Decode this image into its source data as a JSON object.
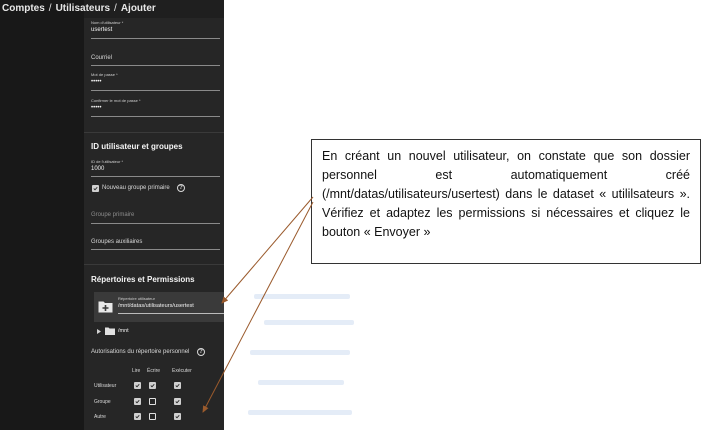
{
  "breadcrumb": [
    "Comptes",
    "Utilisateurs",
    "Ajouter"
  ],
  "breadcrumb_separator": "/",
  "form": {
    "username_label": "Nom d'utilisateur *",
    "username_value": "usertest",
    "email_label": "Courriel",
    "password_label": "Mot de passe *",
    "password_value": "•••••",
    "confirm_label": "Confirmer le mot de passe *",
    "confirm_value": "•••••",
    "section_ids": "ID utilisateur et groupes",
    "uid_label": "ID de l'utilisateur *",
    "uid_value": "1000",
    "new_group_label": "Nouveau groupe primaire",
    "new_group_checked": true,
    "primary_group_label": "Groupe primaire",
    "aux_groups_label": "Groupes auxiliaires",
    "section_dirs": "Répertoires et Permissions",
    "home_dir_label": "Répertoire utilisateur",
    "home_dir_value": "/mnt/datas/utilisateurs/usertest",
    "tree_item": "/mnt",
    "perms_title": "Autorisations du répertoire personnel",
    "perms_columns": [
      "Lire",
      "Écrire",
      "Exécuter"
    ],
    "perms_rows": [
      {
        "label": "Utilisateur",
        "values": [
          true,
          true,
          true
        ]
      },
      {
        "label": "Groupe",
        "values": [
          true,
          false,
          true
        ]
      },
      {
        "label": "Autre",
        "values": [
          true,
          false,
          true
        ]
      }
    ]
  },
  "icons": {
    "help": "help-circle-icon",
    "folder_add": "folder-plus-icon",
    "folder": "folder-icon",
    "expand": "chevron-right-icon",
    "checkbox": "checkmark-icon"
  },
  "callout": {
    "text": "En créant un nouvel utilisateur, on constate que son dossier personnel est automatiquement créé (/mnt/datas/utilisateurs/usertest) dans le dataset « utililsateurs ». Vérifiez et adaptez les permissions si nécessaires et cliquez le bouton « Envoyer »"
  },
  "colors": {
    "app_bg": "#1f1f1f",
    "panel_bg": "#262626",
    "arrow": "#9a5a2c"
  }
}
